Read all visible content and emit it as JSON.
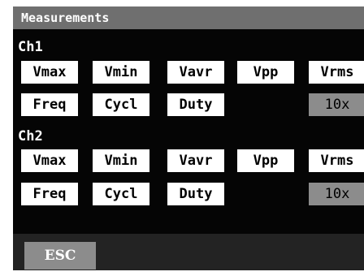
{
  "title": "Measurements",
  "channels": [
    {
      "label": "Ch1",
      "row1": [
        "Vmax",
        "Vmin",
        "Vavr",
        "Vpp",
        "Vrms"
      ],
      "row2": [
        "Freq",
        "Cycl",
        "Duty"
      ],
      "probe": "10x"
    },
    {
      "label": "Ch2",
      "row1": [
        "Vmax",
        "Vmin",
        "Vavr",
        "Vpp",
        "Vrms"
      ],
      "row2": [
        "Freq",
        "Cycl",
        "Duty"
      ],
      "probe": "10x"
    }
  ],
  "esc_label": "ESC",
  "colors": {
    "background": "#050505",
    "titlebar": "#6f6f6f",
    "button": "#ffffff",
    "button_inactive": "#8c8c8c",
    "footer": "#232323"
  }
}
